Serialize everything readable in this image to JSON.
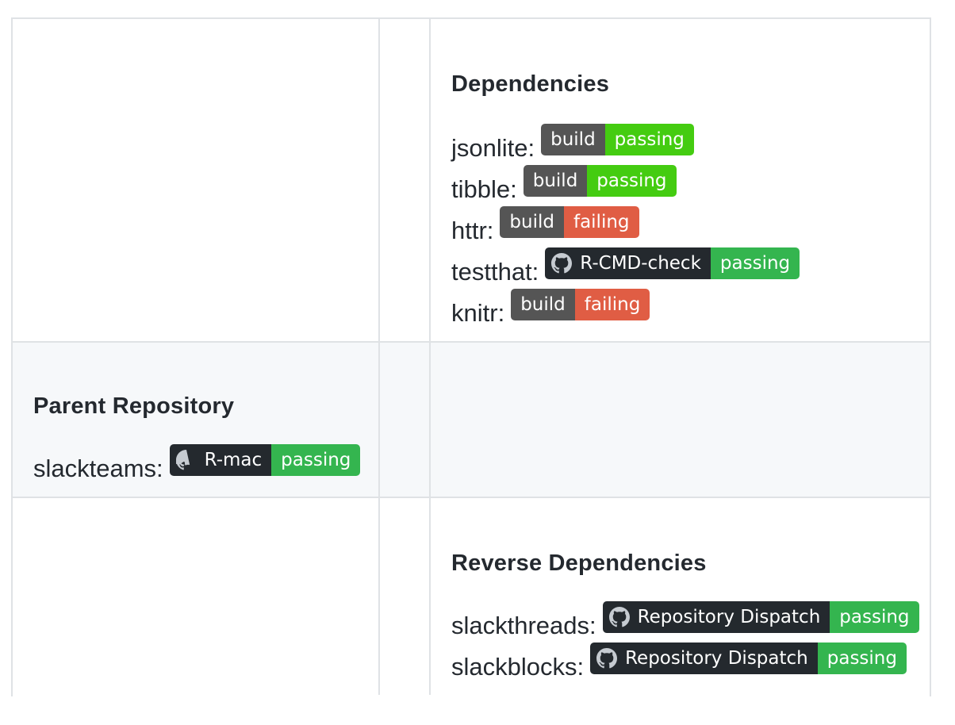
{
  "dependencies": {
    "title": "Dependencies",
    "items": [
      {
        "name": "jsonlite:",
        "left": "build",
        "right": "passing"
      },
      {
        "name": "tibble:",
        "left": "build",
        "right": "passing"
      },
      {
        "name": "httr:",
        "left": "build",
        "right": "failing"
      },
      {
        "name": "testthat:",
        "left": "R-CMD-check",
        "right": "passing"
      },
      {
        "name": "knitr:",
        "left": "build",
        "right": "failing"
      }
    ]
  },
  "parent": {
    "title": "Parent Repository",
    "items": [
      {
        "name": "slackteams:",
        "left": "R-mac",
        "right": "passing"
      }
    ]
  },
  "reverse": {
    "title": "Reverse Dependencies",
    "items": [
      {
        "name": "slackthreads:",
        "left": "Repository Dispatch",
        "right": "passing"
      },
      {
        "name": "slackblocks:",
        "left": "Repository Dispatch",
        "right": "passing"
      }
    ]
  },
  "colors": {
    "passing": "#44cc11",
    "failing": "#e05d44",
    "label_bg": "#555555",
    "github_label_bg": "#24292e"
  }
}
